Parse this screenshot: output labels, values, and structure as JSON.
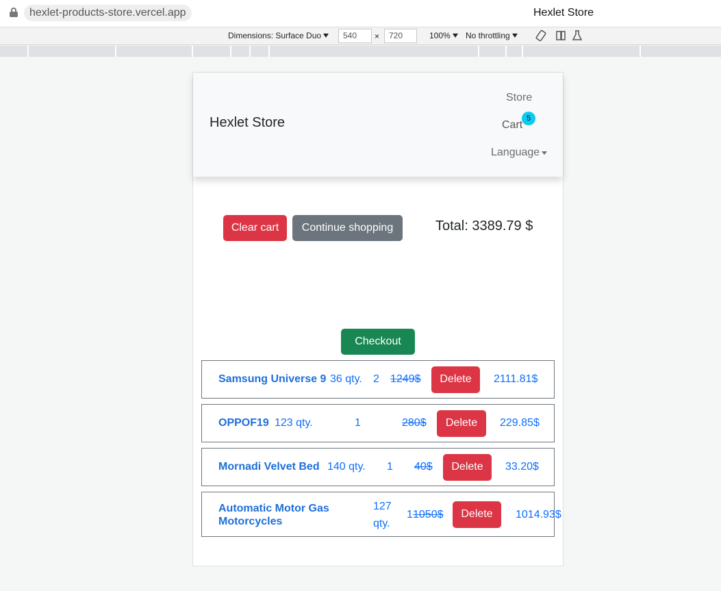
{
  "browser": {
    "url": "hexlet-products-store.vercel.app",
    "tab_title": "Hexlet Store"
  },
  "devtools": {
    "dimensions_label": "Dimensions: Surface Duo",
    "width": "540",
    "times": "×",
    "height": "720",
    "zoom": "100%",
    "throttling": "No throttling"
  },
  "navbar": {
    "brand": "Hexlet Store",
    "store": "Store",
    "cart": "Cart",
    "cart_count": "5",
    "language": "Language"
  },
  "cart": {
    "clear_label": "Clear cart",
    "continue_label": "Continue shopping",
    "total": "Total: 3389.79 $",
    "checkout_label": "Checkout",
    "items": [
      {
        "name": "Samsung Universe 9",
        "stock": "36 qty.",
        "count": "2",
        "old_price": "1249$",
        "delete_label": "Delete",
        "subtotal": "2111.81$"
      },
      {
        "name": "OPPOF19",
        "stock": "123 qty.",
        "count": "1",
        "old_price": "280$",
        "delete_label": "Delete",
        "subtotal": "229.85$"
      },
      {
        "name": "Mornadi Velvet Bed",
        "stock": "140 qty.",
        "count": "1",
        "old_price": "40$",
        "delete_label": "Delete",
        "subtotal": "33.20$"
      },
      {
        "name_line1": "Automatic Motor Gas",
        "name_line2": "Motorcycles",
        "stock_line1": "127",
        "stock_line2": "qty.",
        "count": "1",
        "old_price": "1050$",
        "delete_label": "Delete",
        "subtotal": "1014.93$"
      }
    ]
  },
  "colors": {
    "danger": "#dc3545",
    "secondary": "#6c757d",
    "success": "#198754",
    "link": "#0d6efd",
    "badge": "#0dcaf0"
  }
}
